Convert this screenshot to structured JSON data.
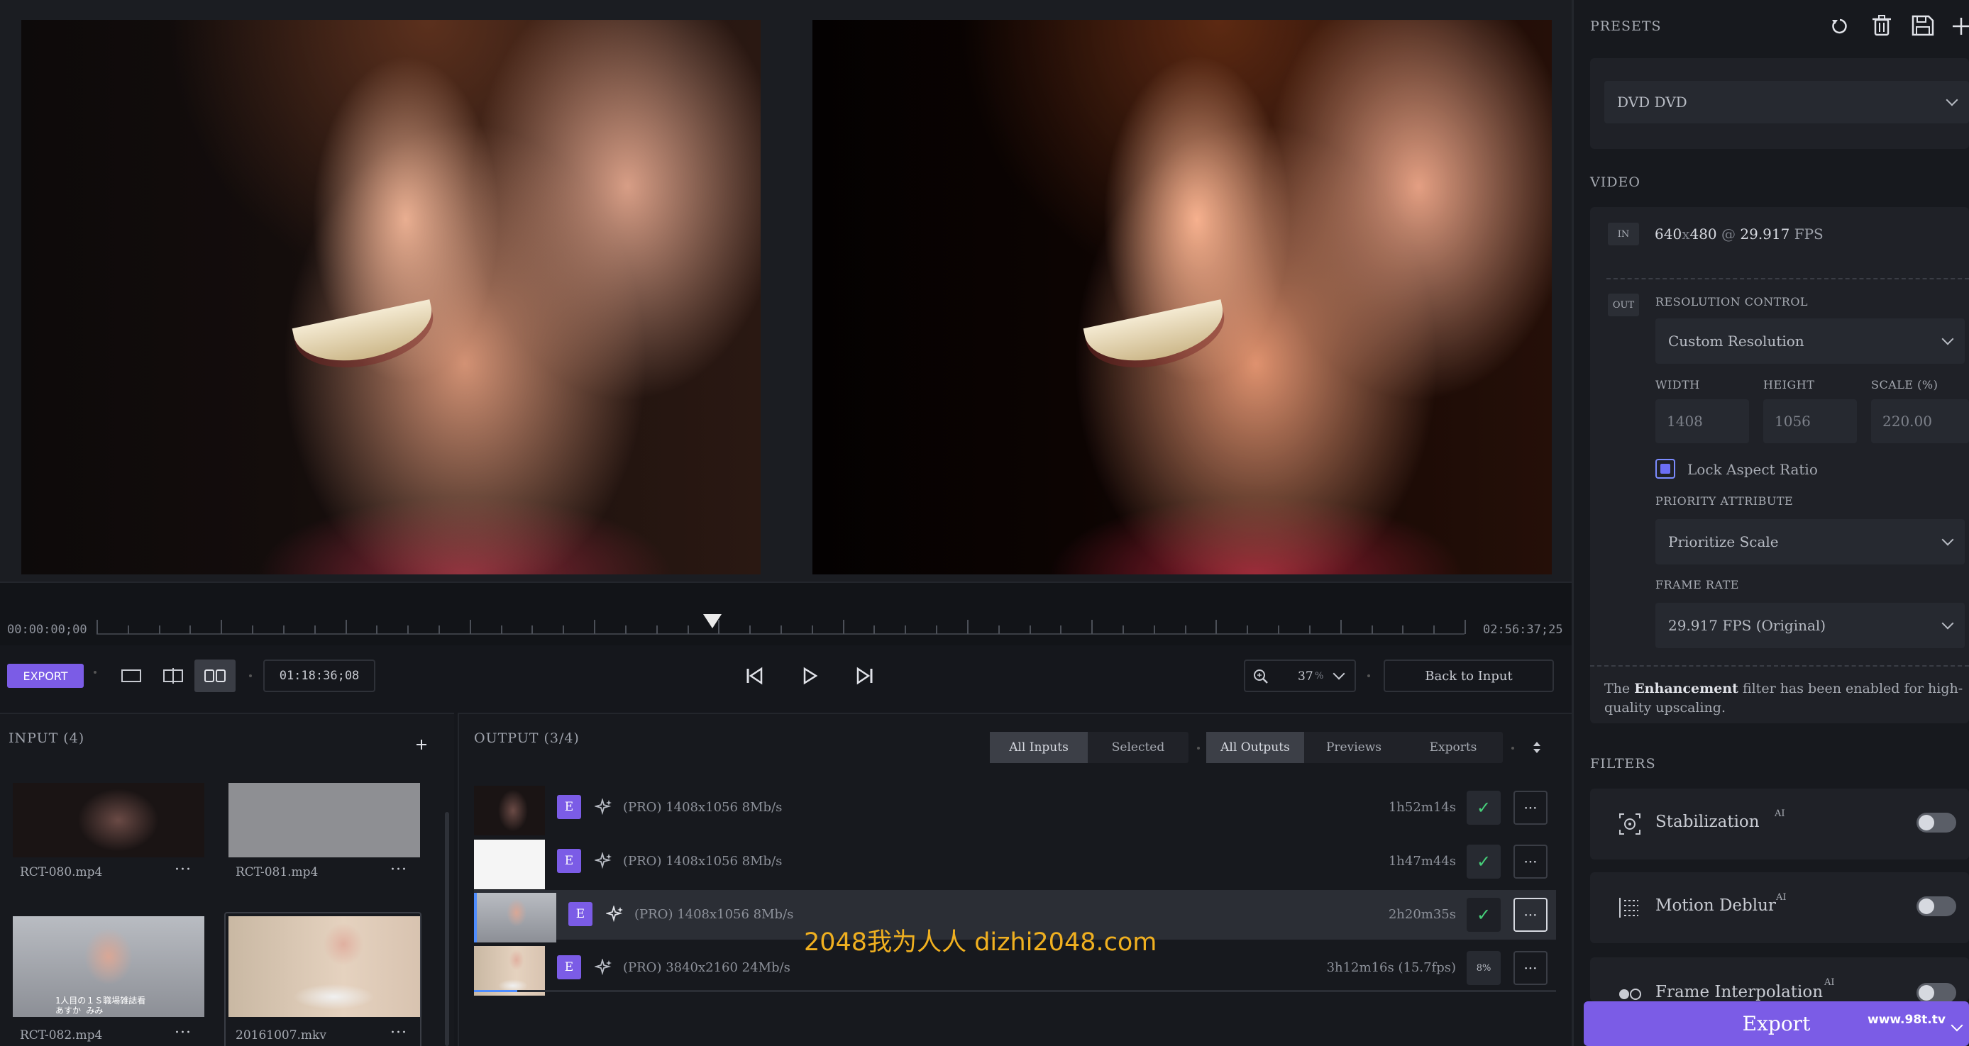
{
  "preview": {
    "left_label": "",
    "right_label": ""
  },
  "timeline": {
    "start_time": "00:00:00;00",
    "end_time": "02:56:37;25",
    "current_time": "01:18:36;08",
    "playhead_fraction": 0.45
  },
  "controls": {
    "export_label": "EXPORT",
    "zoom_value": "37",
    "zoom_unit": "%",
    "back_to_input": "Back to Input"
  },
  "input": {
    "title": "INPUT (4)",
    "add_icon": "plus-icon",
    "files": [
      {
        "name": "RCT-080.mp4",
        "more": "···"
      },
      {
        "name": "RCT-081.mp4",
        "more": "···"
      },
      {
        "name": "RCT-082.mp4",
        "more": "···"
      },
      {
        "name": "20161007.mkv",
        "more": "···"
      }
    ],
    "thumb_caption": "1人目の１Ｓ職場雑誌看\nあすか みみ"
  },
  "output": {
    "title": "OUTPUT (3/4)",
    "filters_left": [
      "All Inputs",
      "Selected"
    ],
    "filters_right": [
      "All Outputs",
      "Previews",
      "Exports"
    ],
    "rows": [
      {
        "badge": "E",
        "desc": "(PRO) 1408x1056 8Mb/s",
        "duration": "1h52m14s",
        "status": "done"
      },
      {
        "badge": "E",
        "desc": "(PRO) 1408x1056 8Mb/s",
        "duration": "1h47m44s",
        "status": "done"
      },
      {
        "badge": "E",
        "desc": "(PRO) 1408x1056 8Mb/s",
        "duration": "2h20m35s",
        "status": "done"
      },
      {
        "badge": "E",
        "desc": "(PRO) 3840x2160 24Mb/s",
        "duration": "3h12m16s (15.7fps)",
        "status": "progress",
        "progress_text": "8%"
      }
    ],
    "more": "···"
  },
  "sidebar": {
    "presets_title": "PRESETS",
    "preset_value": "DVD DVD",
    "video_title": "VIDEO",
    "in_tag": "IN",
    "out_tag": "OUT",
    "in_resolution": "640",
    "in_x": "x",
    "in_resolution_h": "480",
    "in_at": "@",
    "in_fps": "29.917",
    "in_fps_unit": "FPS",
    "resolution_control_label": "RESOLUTION CONTROL",
    "resolution_control_value": "Custom Resolution",
    "width_label": "WIDTH",
    "height_label": "HEIGHT",
    "scale_label": "SCALE (%)",
    "width_value": "1408",
    "height_value": "1056",
    "scale_value": "220.00",
    "lock_aspect_label": "Lock Aspect Ratio",
    "priority_label": "PRIORITY ATTRIBUTE",
    "priority_value": "Prioritize Scale",
    "frame_rate_label": "FRAME RATE",
    "frame_rate_value": "29.917 FPS (Original)",
    "note_prefix": "The",
    "note_bold": "Enhancement",
    "note_suffix": "filter has been enabled for high-quality upscaling.",
    "filters_title": "FILTERS",
    "filters": [
      {
        "name": "Stabilization",
        "ai": "AI",
        "icon": "stabilization-icon",
        "on": false
      },
      {
        "name": "Motion Deblur",
        "ai": "AI",
        "icon": "motion-deblur-icon",
        "on": false
      },
      {
        "name": "Frame Interpolation",
        "ai": "AI",
        "icon": "frame-interpolation-icon",
        "on": false
      }
    ],
    "export_label": "Export"
  },
  "watermark": "2048我为人人 dizhi2048.com",
  "watermark_small": "www.98t.tv",
  "colors": {
    "accent": "#7b5ce6",
    "success": "#46d07a",
    "background": "#15171c"
  }
}
